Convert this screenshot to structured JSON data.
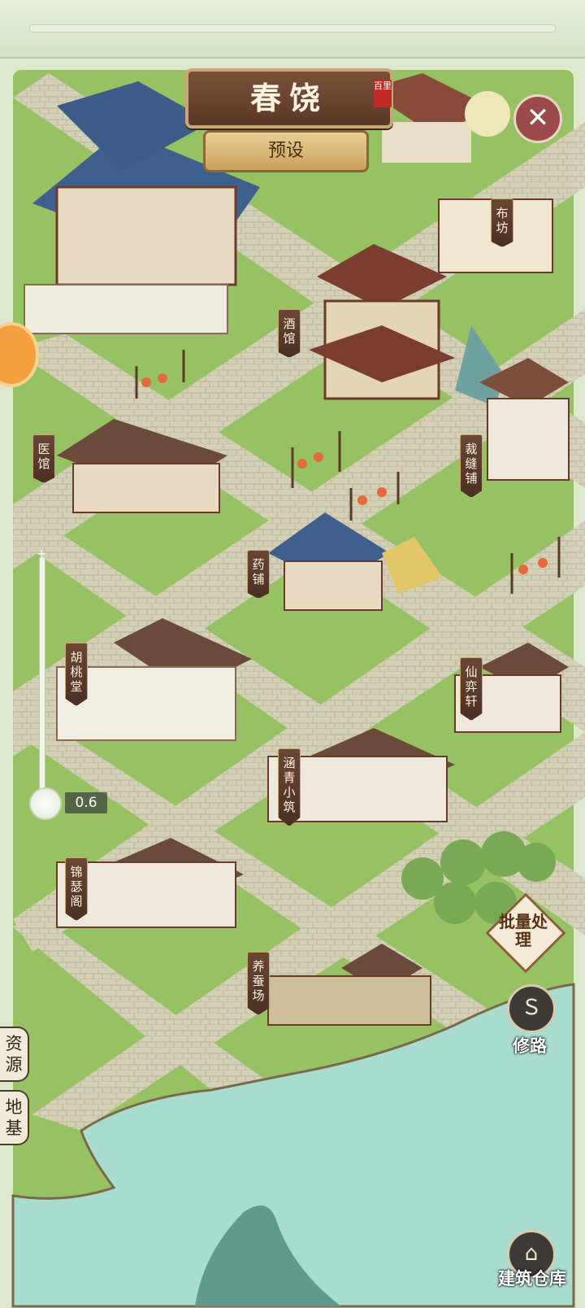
{
  "title": "春饶",
  "title_seal": "百里",
  "preset_button": "预设",
  "close_icon": "close-icon",
  "zoom": {
    "value": "0.6",
    "plus_symbol": "+"
  },
  "buildings": [
    {
      "id": "bufang",
      "label": "布坊"
    },
    {
      "id": "jiuguan",
      "label": "酒馆"
    },
    {
      "id": "yiguan",
      "label": "医馆"
    },
    {
      "id": "caifengpu",
      "label": "裁缝铺"
    },
    {
      "id": "yaopu",
      "label": "药铺"
    },
    {
      "id": "hutaotang",
      "label": "胡桃堂"
    },
    {
      "id": "xianyixuan",
      "label": "仙弈轩"
    },
    {
      "id": "hanqingxiaozhu",
      "label": "涵青小筑"
    },
    {
      "id": "jinsege",
      "label": "锦瑟阁"
    },
    {
      "id": "yangcanchang",
      "label": "养蚕场"
    }
  ],
  "right_buttons": {
    "batch": "批量处理",
    "road": "修路",
    "warehouse": "建筑仓库",
    "road_icon": "road-icon",
    "warehouse_icon": "warehouse-icon"
  },
  "left_tabs": {
    "resources": "资源",
    "foundation": "地基"
  },
  "colors": {
    "grass": "#9cc66a",
    "road": "#d3cdb7",
    "water": "#a9ddd2",
    "banner": "#5e3b28",
    "accent_gold": "#c9a774"
  }
}
